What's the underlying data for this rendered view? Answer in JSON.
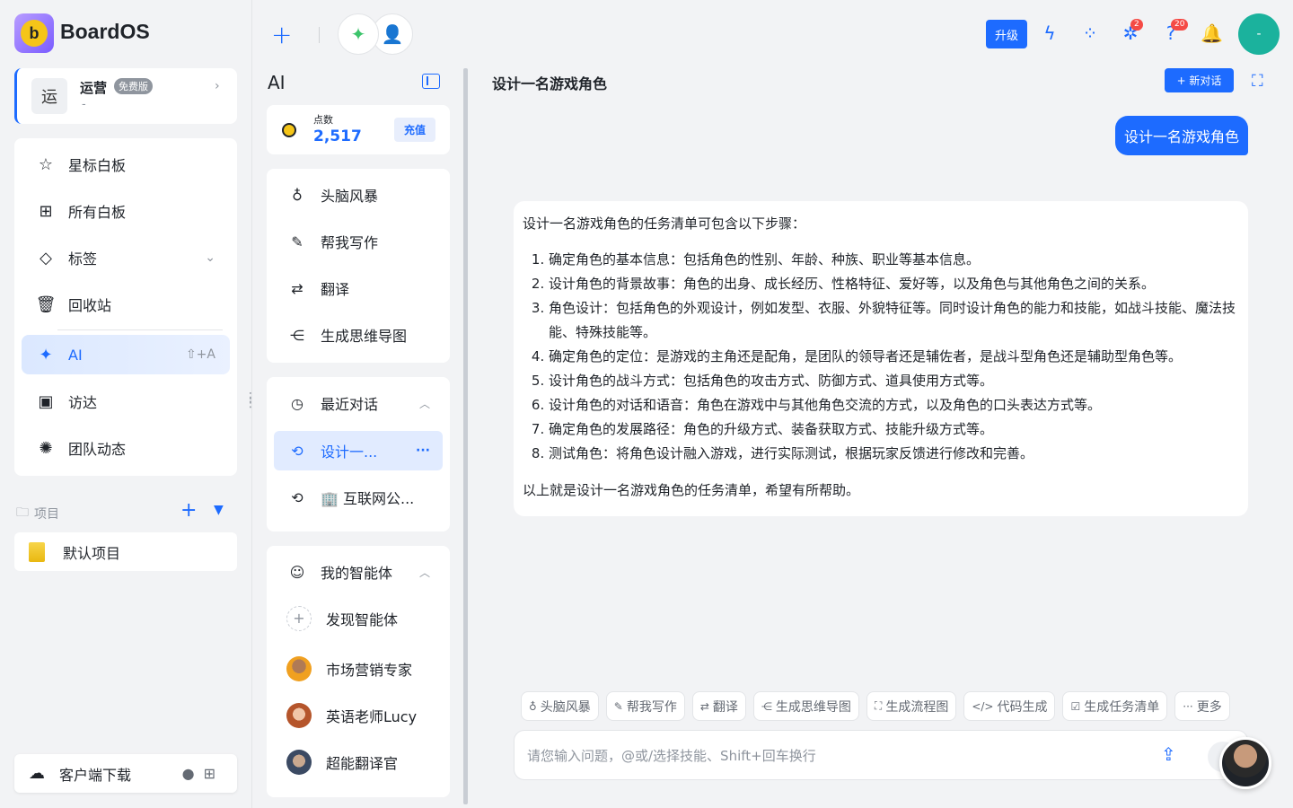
{
  "app": {
    "brand": "BoardOS",
    "logo_letter": "b"
  },
  "workspace": {
    "avatar": "运",
    "name": "运营",
    "plan_badge": "免费版",
    "sub": "-"
  },
  "nav": [
    {
      "icon": "star-icon",
      "glyph": "☆",
      "label": "星标白板"
    },
    {
      "icon": "grid-icon",
      "glyph": "⊞",
      "label": "所有白板"
    },
    {
      "icon": "tag-icon",
      "glyph": "◇",
      "label": "标签",
      "right": "⌄"
    },
    {
      "icon": "trash-icon",
      "glyph": "🗑",
      "label": "回收站"
    },
    {
      "icon": "sparkle-icon",
      "glyph": "✦",
      "label": "AI",
      "right": "⇧+A"
    },
    {
      "icon": "visitor-icon",
      "glyph": "▣",
      "label": "访达"
    },
    {
      "icon": "team-activity-icon",
      "glyph": "✺",
      "label": "团队动态"
    }
  ],
  "projects": {
    "title": "项目",
    "items": [
      "默认项目"
    ]
  },
  "download": {
    "label": "客户端下载",
    "os": ""
  },
  "topbar": {
    "upgrade": "升级",
    "badge_a": "2",
    "badge_b": "20",
    "avatar": "-"
  },
  "ai_panel": {
    "title": "AI",
    "points_label": "点数",
    "points_value": "2,517",
    "recharge": "充值",
    "tools": [
      {
        "icon": "bulb-icon",
        "glyph": "💡",
        "label": "头脑风暴"
      },
      {
        "icon": "magic-pen-icon",
        "glyph": "✎",
        "label": "帮我写作"
      },
      {
        "icon": "translate-icon",
        "glyph": "⇄",
        "label": "翻译"
      },
      {
        "icon": "mindmap-icon",
        "glyph": "⋲",
        "label": "生成思维导图"
      }
    ],
    "recent": {
      "title": "最近对话",
      "items": [
        "设计一...",
        "🏢 互联网公..."
      ],
      "more": "···"
    },
    "agents": {
      "title": "我的智能体",
      "discover": "发现智能体",
      "items": [
        "市场营销专家",
        "英语老师Lucy",
        "超能翻译官"
      ]
    }
  },
  "chat": {
    "title": "设计一名游戏角色",
    "new_chat": "+ 新对话",
    "user_message": "设计一名游戏角色",
    "ai_intro": "设计一名游戏角色的任务清单可包含以下步骤：",
    "ai_steps": [
      "确定角色的基本信息：包括角色的性别、年龄、种族、职业等基本信息。",
      "设计角色的背景故事：角色的出身、成长经历、性格特征、爱好等，以及角色与其他角色之间的关系。",
      "角色设计：包括角色的外观设计，例如发型、衣服、外貌特征等。同时设计角色的能力和技能，如战斗技能、魔法技能、特殊技能等。",
      "确定角色的定位：是游戏的主角还是配角，是团队的领导者还是辅佐者，是战斗型角色还是辅助型角色等。",
      "设计角色的战斗方式：包括角色的攻击方式、防御方式、道具使用方式等。",
      "设计角色的对话和语音：角色在游戏中与其他角色交流的方式，以及角色的口头表达方式等。",
      "确定角色的发展路径：角色的升级方式、装备获取方式、技能升级方式等。",
      "测试角色：将角色设计融入游戏，进行实际测试，根据玩家反馈进行修改和完善。"
    ],
    "ai_outro": "以上就是设计一名游戏角色的任务清单，希望有所帮助。",
    "chips": [
      {
        "icon": "bulb-icon",
        "glyph": "💡",
        "label": "头脑风暴"
      },
      {
        "icon": "magic-pen-icon",
        "glyph": "✎",
        "label": "帮我写作"
      },
      {
        "icon": "translate-icon",
        "glyph": "⇄",
        "label": "翻译"
      },
      {
        "icon": "mindmap-icon",
        "glyph": "⋲",
        "label": "生成思维导图"
      },
      {
        "icon": "flowchart-icon",
        "glyph": "⛶",
        "label": "生成流程图"
      },
      {
        "icon": "code-icon",
        "glyph": "</>",
        "label": "代码生成"
      },
      {
        "icon": "checklist-icon",
        "glyph": "☑",
        "label": "生成任务清单"
      },
      {
        "icon": "more-icon",
        "glyph": "···",
        "label": "更多"
      }
    ],
    "input_placeholder": "请您输入问题，@或/选择技能、Shift+回车换行"
  }
}
